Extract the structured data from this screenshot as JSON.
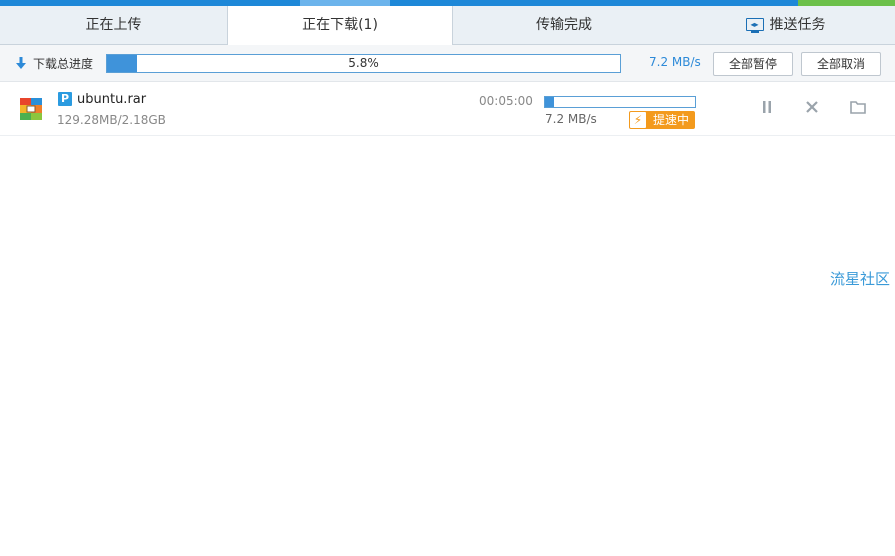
{
  "colors": {
    "accent": "#1e88d8",
    "progress": "#3f93da",
    "boost": "#f39a1d",
    "link": "#2d8ad8"
  },
  "tabs": [
    {
      "label": "正在上传",
      "active": false
    },
    {
      "label": "正在下载(1)",
      "active": true
    },
    {
      "label": "传输完成",
      "active": false
    },
    {
      "label": "推送任务",
      "active": false,
      "icon": "monitor-push-icon"
    }
  ],
  "total": {
    "label": "下载总进度",
    "progress_percent": 5.8,
    "progress_text": "5.8%",
    "speed": "7.2 MB/s",
    "pause_all_label": "全部暂停",
    "cancel_all_label": "全部取消"
  },
  "tasks": [
    {
      "name": "ubuntu.rar",
      "type_badge": "P",
      "size": "129.28MB/2.18GB",
      "time_remaining": "00:05:00",
      "progress_percent": 5.8,
      "speed": "7.2 MB/s",
      "boost_label": "提速中",
      "file_icon": "archive-file-icon"
    }
  ],
  "watermark": "流星社区"
}
